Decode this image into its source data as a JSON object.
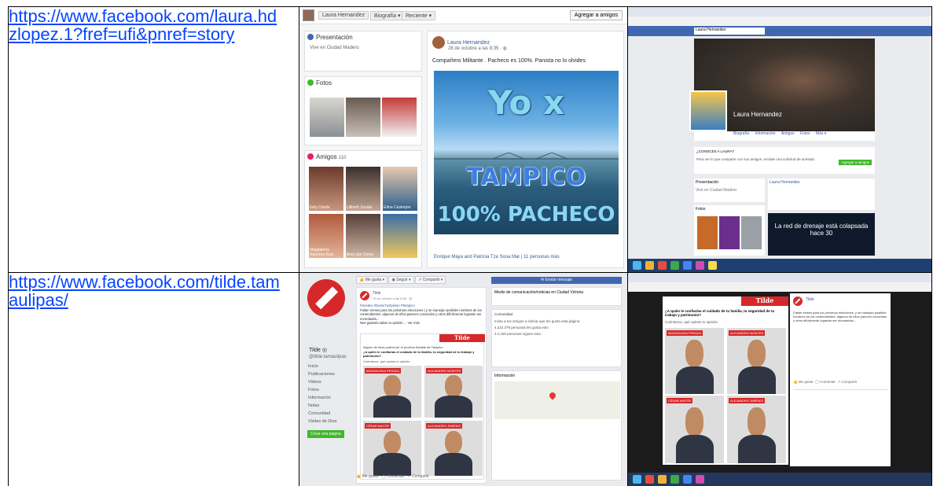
{
  "rows": [
    {
      "url": "https://www.facebook.com/laura.hdzlopez.1?fref=ufi&pnref=story",
      "shot1": {
        "tab_name": "Laura Hernandez",
        "tab_bio": "Biografía ▾",
        "tab_recent": "Reciente ▾",
        "add_friend": "Agregar a amigos",
        "intro_title": "Presentación",
        "lives_in": "Vive en Ciudad Madero",
        "photos_title": "Fotos",
        "friends_title": "Amigos",
        "friends_count": "110",
        "friend_names": [
          "Indy Conde",
          "Lilibeth Zavala",
          "Edna Castrejon",
          "Magdalena Ramírez Ruiz",
          "Ana Lilia Torres",
          ""
        ],
        "poster_name": "Laura Hernandez",
        "poster_date": "28 de octubre a las 8:35 · ◍",
        "post_text": "Compañero Militante . Pacheco es 100%. Panista no lo olvides",
        "poster_line1": "Yo x",
        "poster_line2": "TAMPICO",
        "poster_line3": "100% PACHECO",
        "post_footer": "Enrique Maya and Patricia Tze Sosa Mar  |  11 personas más"
      },
      "shot2": {
        "profile_name": "Laura Hernandez",
        "search_value": "Laura Hernandez",
        "nav_items": [
          "Biografía",
          "Información",
          "Amigos",
          "Fotos",
          "Más ▾"
        ],
        "know_box": "¿CONOCES A LAURA?",
        "know_text": "Para ver lo que comparte con sus amigos, envíale una solicitud de amistad.",
        "add_friend": "Agregar a amigos",
        "intro_title": "Presentación",
        "lives": "Vive en Ciudad Madero",
        "photos_title": "Fotos",
        "post_author": "Laura Hernandez",
        "ad_text": "La red de drenaje está colapsada hace 30"
      }
    },
    {
      "url": "https://www.facebook.com/tilde.tamaulipas/",
      "shot1": {
        "page_name": "Tilde ◎",
        "page_handle": "@tilde.tamaulipas",
        "nav_items": [
          "Inicio",
          "Publicaciones",
          "Videos",
          "Fotos",
          "Información",
          "Notas",
          "Comunidad",
          "Visitas de Diva"
        ],
        "create_page": "Crear una página",
        "actions": [
          "👍 Me gusta ▾",
          "◉ Seguir ▾",
          "↗ Compartir ▾"
        ],
        "send_msg": "✉ Enviar mensaje",
        "post_author": "Tilde",
        "post_date": "29 de octubre a las 8:38 · ◍",
        "post_tags": "#Sondeo #DameTuOpinion #Tampico",
        "post_text": "Faltan meses para los próximos elecciones | y se manejan posibles nombres de los contendientes. algunos de ellos parecen conocidos y otros difícilmente lograrán ser recordados...",
        "post_cta": "Nos gustaría saber tu opinión ... Ver más",
        "banner_title": "Tilde",
        "survey_q1": "Alguno de ellos podría ser el próximo Alcalde de Tampico",
        "survey_q2": "¿A quién le confiarías el cuidado de tu familia, tu seguridad de tu trabajo y patrimonio?",
        "survey_q3": "Cuéntanos, qué opinas tu opinión",
        "candidates": [
          "MAGDALENA PERAZA",
          "ALEJANDRO MONTES",
          "CÉSAR ANSTÍE",
          "ALEJANDRO JIMÉNEZ"
        ],
        "right_info": "Medio de comunicación/noticias en Ciudad Victoria",
        "community": "Comunidad",
        "stats": [
          "Invita a tus amigos a indicar que les gusta esta página",
          "4.222.379 personas les gusta esto",
          "4.2.160 personas siguen esto"
        ],
        "info_title": "Información",
        "footer_actions": [
          "👍 Me gusta",
          "◯ Comentar",
          "↗ Compartir"
        ]
      },
      "shot2": {
        "post_author": "Tilde",
        "post_text": "Faltan meses para los próximos elecciones, y se manejan posibles nombres de los contendientes. algunos de ellos parecen conocidos y otros difícilmente lograrán ser recordados...",
        "banner_title": "Tilde",
        "survey_q": "¿A quién le confiarías el cuidado de tu familia, tu seguridad de tu trabajo y patrimonio?",
        "cta": "Cuéntanos, qué opinas tu opinión",
        "candidates": [
          "MAGDALENA PERAZA",
          "ALEJANDRO MONTES",
          "CÉSAR ANSTÍE",
          "ALEJANDRO JIMÉNEZ"
        ],
        "actions": [
          "👍 Me gusta",
          "◯ Comentar",
          "↗ Compartir"
        ]
      }
    }
  ]
}
